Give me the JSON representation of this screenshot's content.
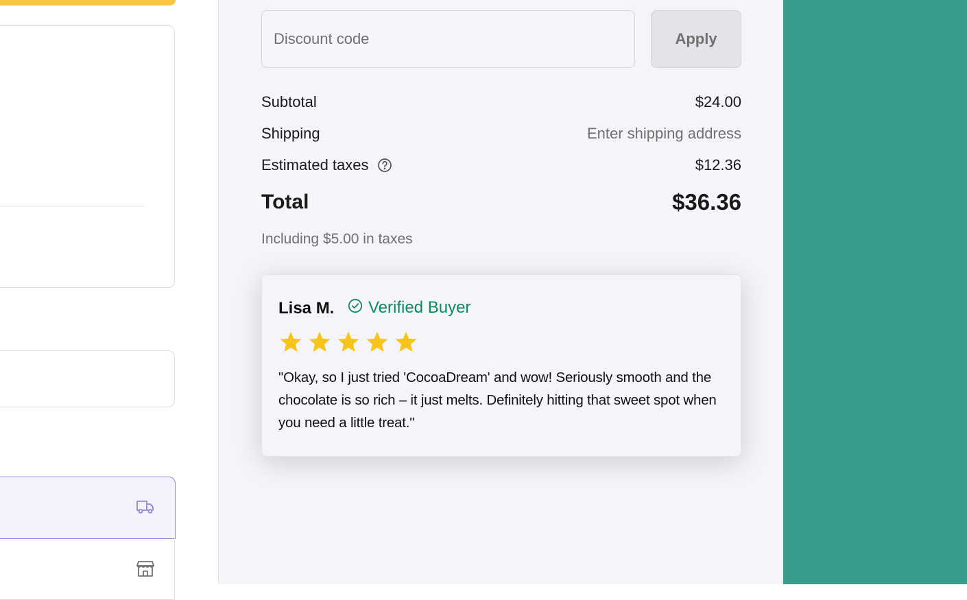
{
  "discount": {
    "placeholder": "Discount code",
    "apply_label": "Apply"
  },
  "summary": {
    "subtotal_label": "Subtotal",
    "subtotal_value": "$24.00",
    "shipping_label": "Shipping",
    "shipping_value": "Enter shipping address",
    "taxes_label": "Estimated taxes",
    "taxes_value": "$12.36",
    "total_label": "Total",
    "total_value": "$36.36",
    "tax_note": "Including $5.00 in taxes"
  },
  "review": {
    "name": "Lisa M.",
    "badge": "Verified Buyer",
    "rating": 5,
    "rating_max": 5,
    "text": "\"Okay, so I just tried 'CocoaDream' and wow! Seriously smooth and the chocolate is so rich – it just melts. Definitely hitting that sweet spot when you need a little treat.\""
  },
  "icons": {
    "shipping_option": "truck-icon",
    "pickup_option": "store-icon",
    "tax_help": "question-circle-icon",
    "verified": "check-circle-icon",
    "rating": "star-icon"
  },
  "colors": {
    "accent_yellow": "#f9c440",
    "selected_border": "#8e86d9",
    "verified_green": "#0b8a5e",
    "star_gold": "#f8c41c",
    "teal_background": "#3a9d8b"
  }
}
